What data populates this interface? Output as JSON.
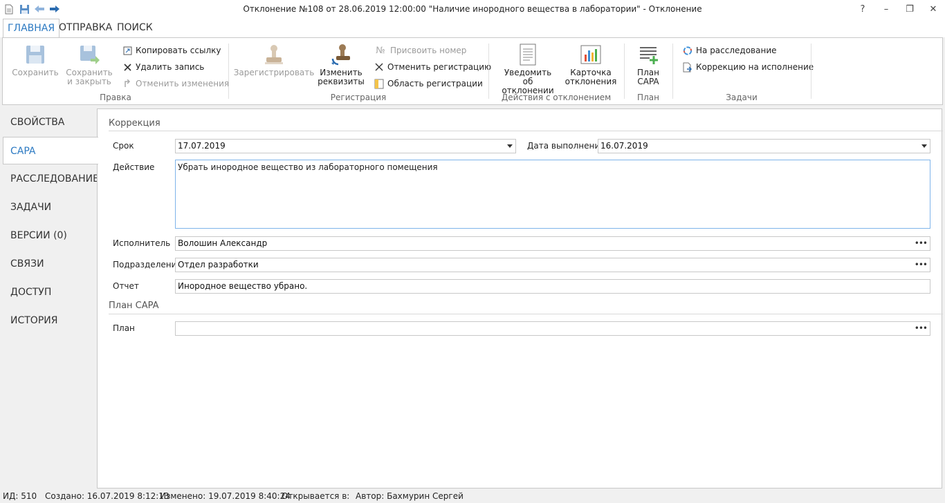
{
  "window": {
    "title": "Отклонение №108 от 28.06.2019 12:00:00 \"Наличие инородного вещества в лаборатории\" - Отклонение",
    "help": "?",
    "minimize": "–",
    "restore": "❐",
    "close": "✕"
  },
  "tabs": [
    "ГЛАВНАЯ",
    "ОТПРАВКА",
    "ПОИСК"
  ],
  "ribbon": {
    "pravka": {
      "label": "Правка",
      "save": "Сохранить",
      "save_close_1": "Сохранить",
      "save_close_2": "и закрыть",
      "copy_link": "Копировать ссылку",
      "delete_record": "Удалить запись",
      "undo_changes": "Отменить изменения"
    },
    "registration": {
      "label": "Регистрация",
      "register": "Зарегистрировать",
      "change_1": "Изменить",
      "change_2": "реквизиты",
      "assign_number": "Присвоить номер",
      "cancel_registration": "Отменить регистрацию",
      "registration_area": "Область регистрации"
    },
    "actions": {
      "label": "Действия с отклонением",
      "notify_1": "Уведомить об",
      "notify_2": "отклонении",
      "card_1": "Карточка",
      "card_2": "отклонения"
    },
    "plan": {
      "label": "План",
      "plan_1": "План",
      "plan_2": "CAPA"
    },
    "tasks": {
      "label": "Задачи",
      "to_investigation": "На расследование",
      "correction": "Коррекцию на исполнение"
    }
  },
  "nav": [
    "СВОЙСТВА",
    "CAPA",
    "РАССЛЕДОВАНИЕ",
    "ЗАДАЧИ",
    "ВЕРСИИ (0)",
    "СВЯЗИ",
    "ДОСТУП",
    "ИСТОРИЯ"
  ],
  "form": {
    "section_correction": "Коррекция",
    "deadline_label": "Срок",
    "deadline_value": "17.07.2019",
    "done_label": "Дата выполнения",
    "done_value": "16.07.2019",
    "action_label": "Действие",
    "action_value": "Убрать инородное вещество из лабораторного помещения",
    "executor_label": "Исполнитель",
    "executor_value": "Волошин Александр",
    "department_label": "Подразделение",
    "department_value": "Отдел разработки",
    "report_label": "Отчет",
    "report_value": "Инородное вещество убрано.",
    "section_plan": "План CAPA",
    "plan_label": "План",
    "plan_value": ""
  },
  "status": {
    "id": "ИД: 510",
    "created": "Создано: 16.07.2019 8:12:13",
    "changed": "Изменено: 19.07.2019 8:40:24",
    "opens_in": "Открывается в:",
    "author": "Автор: Бахмурин Сергей"
  }
}
